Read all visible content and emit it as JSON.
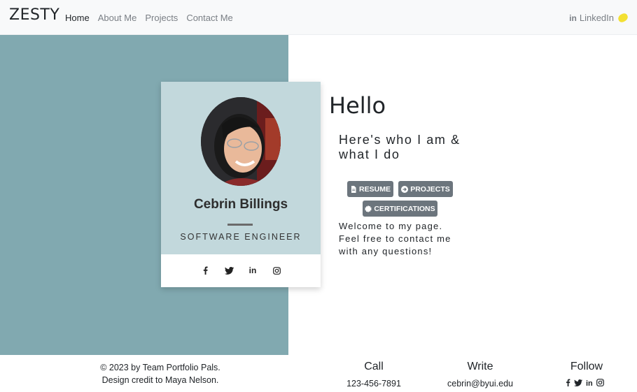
{
  "navbar": {
    "brand": "ZESTY",
    "links": [
      {
        "label": "Home"
      },
      {
        "label": "About Me"
      },
      {
        "label": "Projects"
      },
      {
        "label": "Contact Me"
      }
    ],
    "linkedin_label": "LinkedIn",
    "linkedin_icon": "linkedin-icon",
    "lemon_icon": "lemon-icon"
  },
  "profile": {
    "name": "Cebrin Billings",
    "role": "SOFTWARE ENGINEER",
    "social_icons": [
      "facebook-icon",
      "twitter-icon",
      "linkedin-icon",
      "instagram-icon"
    ]
  },
  "intro": {
    "greeting": "Hello",
    "tagline": "Here's who I am & what I do",
    "buttons": [
      {
        "label": "RESUME",
        "icon": "document-icon"
      },
      {
        "label": "PROJECTS",
        "icon": "arrow-circle-icon"
      },
      {
        "label": "CERTIFICATIONS",
        "icon": "certificate-icon"
      }
    ],
    "welcome": "Welcome to my page. Feel free to contact me with any questions!"
  },
  "footer": {
    "credit_line1": "© 2023 by Team Portfolio Pals.",
    "credit_line2": "Design credit to Maya Nelson.",
    "call_title": "Call",
    "call_value": "123-456-7891",
    "write_title": "Write",
    "write_value": "cebrin@byui.edu",
    "follow_title": "Follow",
    "follow_icons": [
      "facebook-icon",
      "twitter-icon",
      "linkedin-icon",
      "instagram-icon"
    ]
  },
  "colors": {
    "hero_bg": "#81a9b0",
    "card_top": "#c2d8dc",
    "button": "#6c757d",
    "navbar": "#f8f9fa"
  }
}
